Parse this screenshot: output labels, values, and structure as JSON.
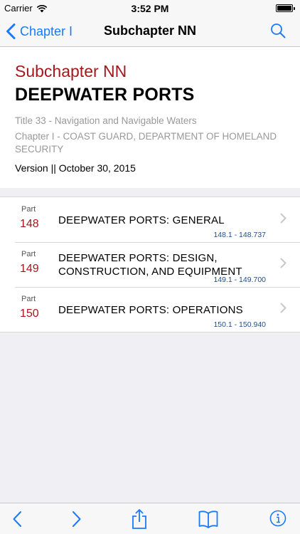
{
  "status_bar": {
    "carrier": "Carrier",
    "time": "3:52 PM"
  },
  "nav": {
    "back_label": "Chapter I",
    "title": "Subchapter NN"
  },
  "header": {
    "subchapter_label": "Subchapter NN",
    "subchapter_title": "DEEPWATER PORTS",
    "title_line": "Title 33 - Navigation and Navigable Waters",
    "chapter_line": "Chapter I - COAST GUARD, DEPARTMENT OF HOMELAND SECURITY",
    "version": "Version || October 30, 2015"
  },
  "parts": [
    {
      "label": "Part",
      "number": "148",
      "title": "DEEPWATER PORTS: GENERAL",
      "range": "148.1 - 148.737"
    },
    {
      "label": "Part",
      "number": "149",
      "title": "DEEPWATER PORTS: DESIGN, CONSTRUCTION, AND EQUIPMENT",
      "range": "149.1 - 149.700"
    },
    {
      "label": "Part",
      "number": "150",
      "title": "DEEPWATER PORTS: OPERATIONS",
      "range": "150.1 - 150.940"
    }
  ],
  "colors": {
    "accent": "#1a7af8",
    "part_number": "#a3181d",
    "range": "#1f4e89"
  },
  "toolbar": {
    "icons": [
      "back-arrow-icon",
      "forward-arrow-icon",
      "share-icon",
      "bookmarks-icon",
      "info-icon"
    ]
  }
}
